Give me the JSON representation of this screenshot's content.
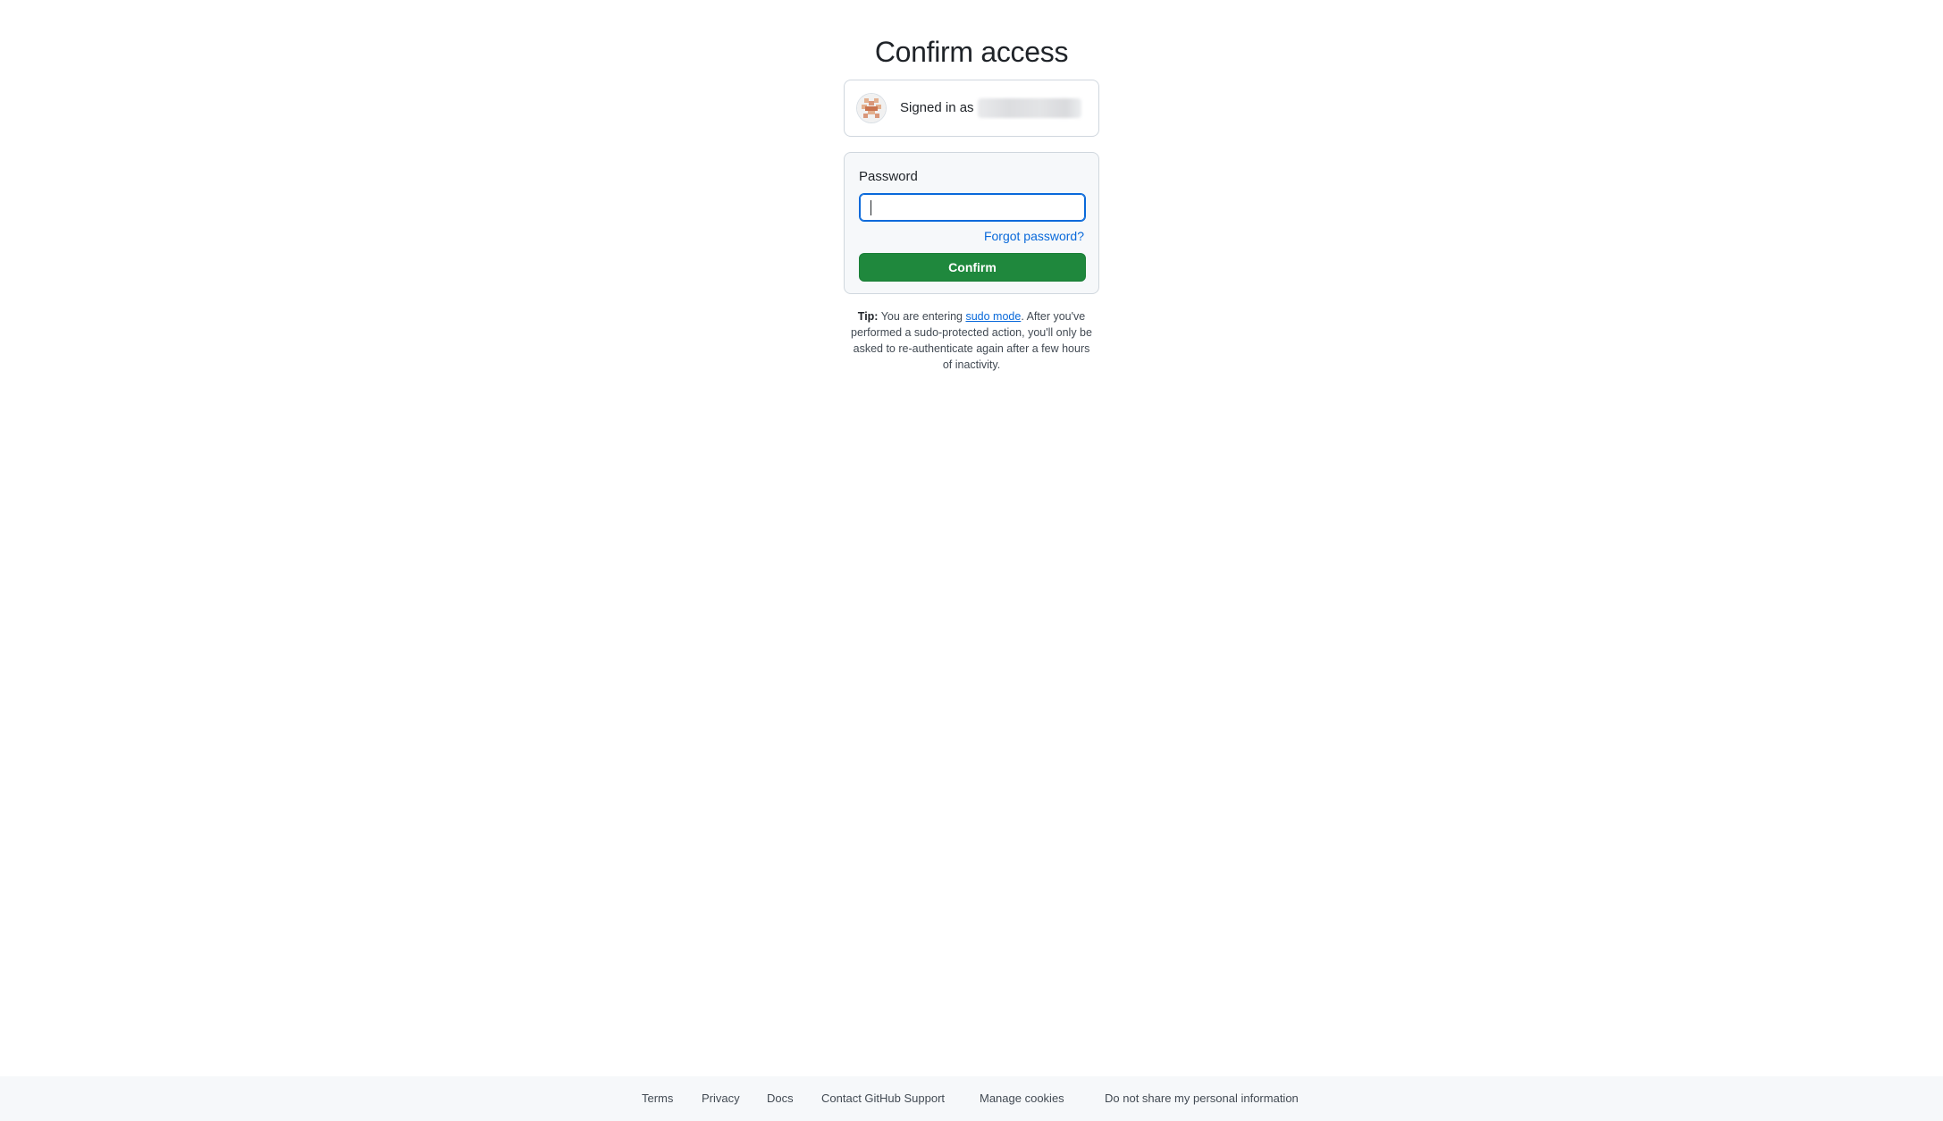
{
  "page": {
    "title": "Confirm access"
  },
  "account": {
    "signed_in_label": "Signed in as",
    "username_redacted": true
  },
  "form": {
    "password_label": "Password",
    "password_value": "",
    "forgot_link": "Forgot password?",
    "confirm_label": "Confirm"
  },
  "tip": {
    "prefix": "Tip:",
    "text_before_link": " You are entering ",
    "link_text": "sudo mode",
    "text_after_link": ". After you've performed a sudo-protected action, you'll only be asked to re-authenticate again after a few hours of inactivity."
  },
  "footer": {
    "links": [
      "Terms",
      "Privacy",
      "Docs",
      "Contact GitHub Support",
      "Manage cookies",
      "Do not share my personal information"
    ]
  },
  "colors": {
    "accent": "#0969da",
    "confirm_button": "#1f883d",
    "box_border": "#d0d7de",
    "box_background": "#f6f8fa"
  },
  "icons": {
    "avatar": "identicon-avatar"
  }
}
